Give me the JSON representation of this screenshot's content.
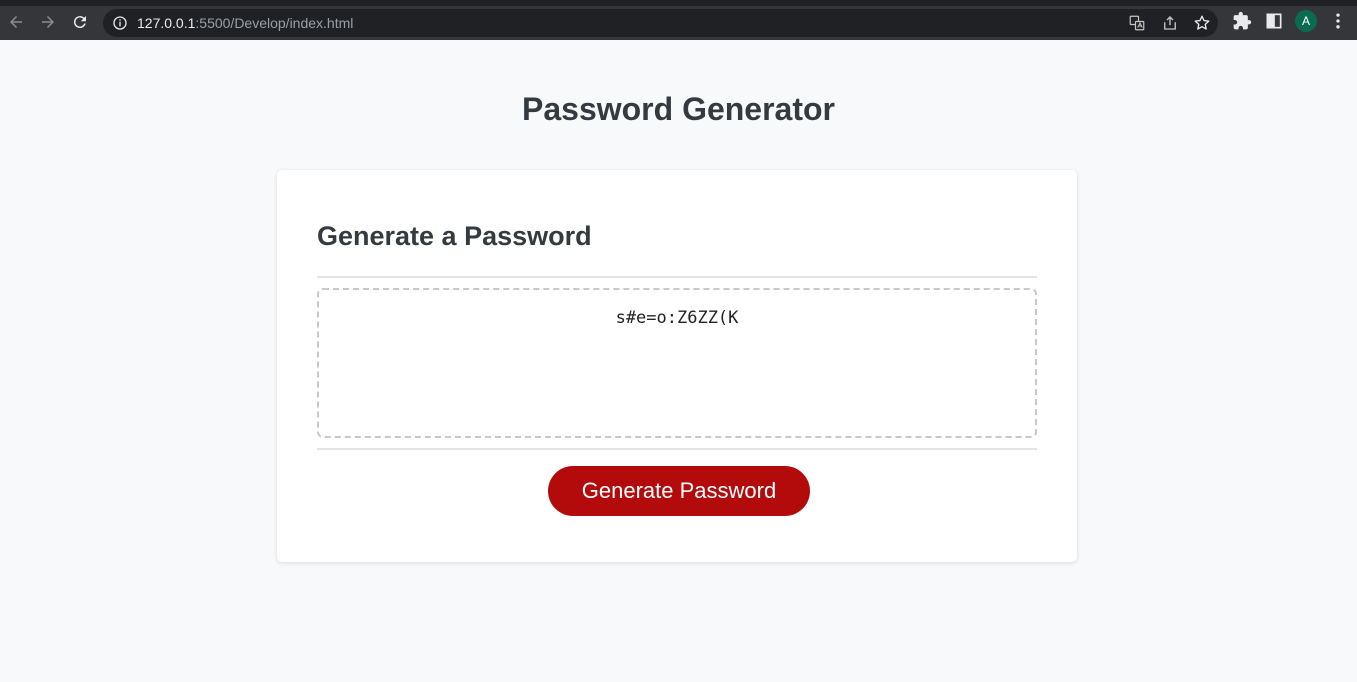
{
  "browser": {
    "url_host": "127.0.0.1",
    "url_path": ":5500/Develop/index.html",
    "profile_initial": "A",
    "icons": [
      "back-icon",
      "forward-icon",
      "reload-icon",
      "info-icon",
      "translate-icon",
      "share-icon",
      "star-icon",
      "extensions-icon",
      "side-panel-icon",
      "menu-icon"
    ]
  },
  "page": {
    "title": "Password Generator",
    "card_header": "Generate a Password",
    "password": "s#e=o:Z6ZZ(K",
    "generate_label": "Generate Password"
  },
  "colors": {
    "accent": "#b30b0b",
    "heading": "#343a40",
    "background": "#f8f9fa"
  }
}
